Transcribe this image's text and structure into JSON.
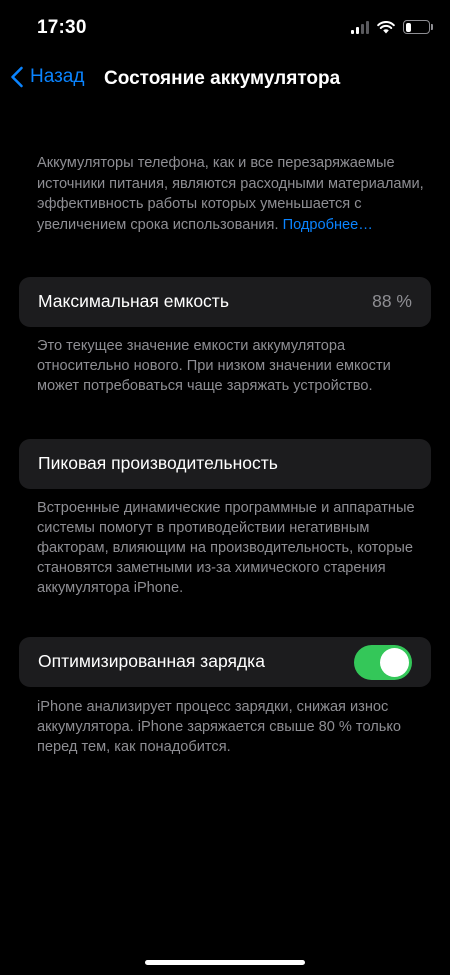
{
  "status_bar": {
    "time": "17:30",
    "signal_icon": "cellular-signal-icon",
    "wifi_icon": "wifi-icon",
    "battery_icon": "battery-icon",
    "battery_level": 0.25
  },
  "nav": {
    "back_label": "Назад",
    "title": "Состояние аккумулятора"
  },
  "intro": {
    "text": "Аккумуляторы телефона, как и все перезаряжаемые источники питания, являются расходными материалами, эффективность работы которых уменьшается с увеличением срока использования. ",
    "link": "Подробнее…"
  },
  "max_capacity": {
    "label": "Максимальная емкость",
    "value": "88 %",
    "footer": "Это текущее значение емкости аккумулятора относительно нового. При низком значении емкости может потребоваться чаще заряжать устройство."
  },
  "peak_performance": {
    "label": "Пиковая производительность",
    "footer": "Встроенные динамические программные и аппаратные системы помогут в противодействии негативным факторам, влияющим на производительность, которые становятся заметными из-за химического старения аккумулятора iPhone."
  },
  "optimized_charging": {
    "label": "Оптимизированная зарядка",
    "enabled": true,
    "footer": "iPhone анализирует процесс зарядки, снижая износ аккумулятора. iPhone заряжается свыше 80 % только перед тем, как понадобится."
  },
  "colors": {
    "accent": "#0a84ff",
    "toggle_on": "#34c759",
    "cell_background": "#1c1c1e",
    "secondary_text": "#8e8e93"
  }
}
